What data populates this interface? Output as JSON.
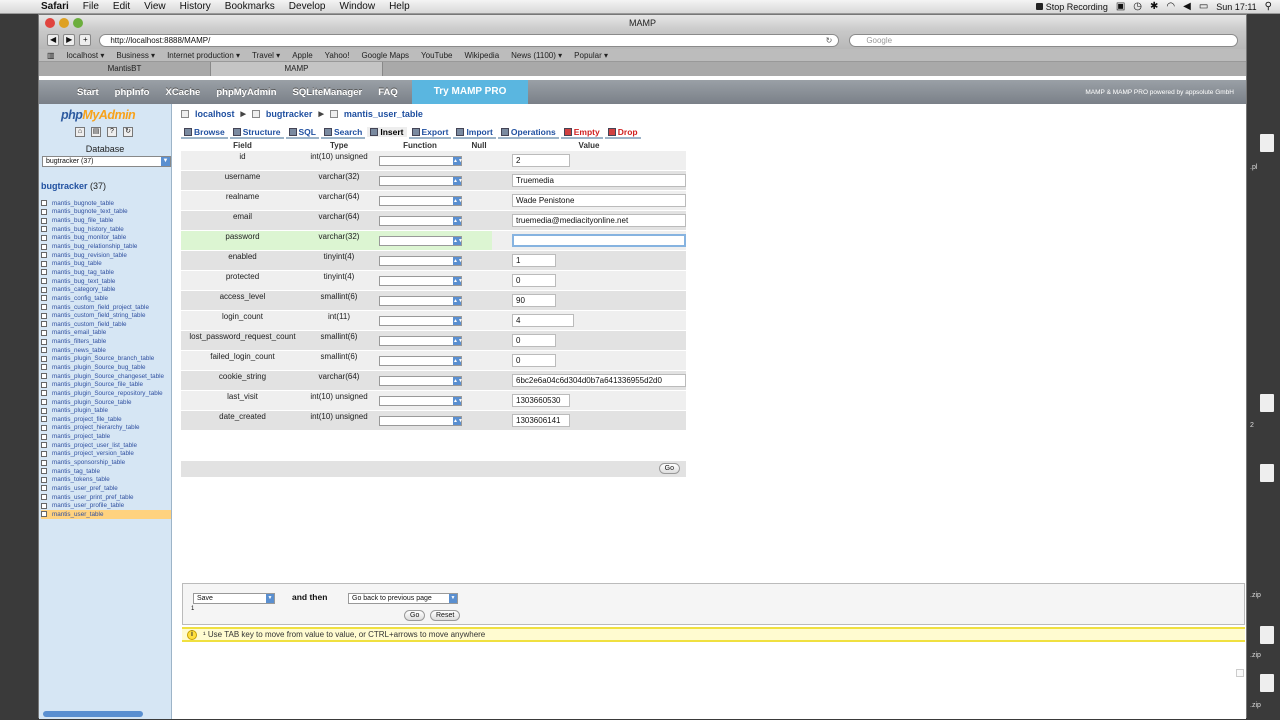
{
  "menubar": {
    "items": [
      "Safari",
      "File",
      "Edit",
      "View",
      "History",
      "Bookmarks",
      "Develop",
      "Window",
      "Help"
    ],
    "recording": "Stop Recording",
    "clock": "Sun 17:11"
  },
  "window": {
    "title": "MAMP"
  },
  "toolbar": {
    "url": "http://localhost:8888/MAMP/",
    "search_placeholder": "Google"
  },
  "bookmarks": [
    "localhost ▾",
    "Business ▾",
    "Internet production ▾",
    "Travel ▾",
    "Apple",
    "Yahoo!",
    "Google Maps",
    "YouTube",
    "Wikipedia",
    "News (1100) ▾",
    "Popular ▾"
  ],
  "tabs": [
    "MantisBT",
    "MAMP"
  ],
  "mamp_nav": {
    "items": [
      "Start",
      "phpInfo",
      "XCache",
      "phpMyAdmin",
      "SQLiteManager",
      "FAQ"
    ],
    "try_label": "Try MAMP PRO",
    "powered": "MAMP & MAMP PRO powered by appsolute GmbH"
  },
  "left": {
    "logo_php": "php",
    "logo_myadmin": "MyAdmin",
    "db_label": "Database",
    "db_select": "bugtracker (37)",
    "db_name": "bugtracker",
    "db_count": "(37)",
    "tables": [
      "mantis_bugnote_table",
      "mantis_bugnote_text_table",
      "mantis_bug_file_table",
      "mantis_bug_history_table",
      "mantis_bug_monitor_table",
      "mantis_bug_relationship_table",
      "mantis_bug_revision_table",
      "mantis_bug_table",
      "mantis_bug_tag_table",
      "mantis_bug_text_table",
      "mantis_category_table",
      "mantis_config_table",
      "mantis_custom_field_project_table",
      "mantis_custom_field_string_table",
      "mantis_custom_field_table",
      "mantis_email_table",
      "mantis_filters_table",
      "mantis_news_table",
      "mantis_plugin_Source_branch_table",
      "mantis_plugin_Source_bug_table",
      "mantis_plugin_Source_changeset_table",
      "mantis_plugin_Source_file_table",
      "mantis_plugin_Source_repository_table",
      "mantis_plugin_Source_table",
      "mantis_plugin_table",
      "mantis_project_file_table",
      "mantis_project_hierarchy_table",
      "mantis_project_table",
      "mantis_project_user_list_table",
      "mantis_project_version_table",
      "mantis_sponsorship_table",
      "mantis_tag_table",
      "mantis_tokens_table",
      "mantis_user_pref_table",
      "mantis_user_print_pref_table",
      "mantis_user_profile_table",
      "mantis_user_table"
    ],
    "selected_table": "mantis_user_table"
  },
  "breadcrumb": [
    "localhost",
    "bugtracker",
    "mantis_user_table"
  ],
  "pma_tabs": [
    "Browse",
    "Structure",
    "SQL",
    "Search",
    "Insert",
    "Export",
    "Import",
    "Operations",
    "Empty",
    "Drop"
  ],
  "pma_active": "Insert",
  "insert_table": {
    "headers": [
      "Field",
      "Type",
      "Function",
      "Null",
      "Value"
    ],
    "rows": [
      {
        "field": "id",
        "type": "int(10) unsigned",
        "value": "2"
      },
      {
        "field": "username",
        "type": "varchar(32)",
        "value": "Truemedia"
      },
      {
        "field": "realname",
        "type": "varchar(64)",
        "value": "Wade Penistone"
      },
      {
        "field": "email",
        "type": "varchar(64)",
        "value": "truemedia@mediacityonline.net"
      },
      {
        "field": "password",
        "type": "varchar(32)",
        "value": ""
      },
      {
        "field": "enabled",
        "type": "tinyint(4)",
        "value": "1"
      },
      {
        "field": "protected",
        "type": "tinyint(4)",
        "value": "0"
      },
      {
        "field": "access_level",
        "type": "smallint(6)",
        "value": "90"
      },
      {
        "field": "login_count",
        "type": "int(11)",
        "value": "4"
      },
      {
        "field": "lost_password_request_count",
        "type": "smallint(6)",
        "value": "0"
      },
      {
        "field": "failed_login_count",
        "type": "smallint(6)",
        "value": "0"
      },
      {
        "field": "cookie_string",
        "type": "varchar(64)",
        "value": "6bc2e6a04c6d304d0b7a641336955d2d0"
      },
      {
        "field": "last_visit",
        "type": "int(10) unsigned",
        "value": "1303660530"
      },
      {
        "field": "date_created",
        "type": "int(10) unsigned",
        "value": "1303606141"
      }
    ],
    "go_label": "Go"
  },
  "action": {
    "save": "Save",
    "and_then": "and then",
    "then_select": "Go back to previous page",
    "footnote": "1",
    "go": "Go",
    "reset": "Reset"
  },
  "notice": "¹ Use TAB key to move from value to value, or CTRL+arrows to move anywhere",
  "desktop_labels": [
    ".pl",
    "2",
    ".zip",
    ".zip",
    ".zip"
  ]
}
